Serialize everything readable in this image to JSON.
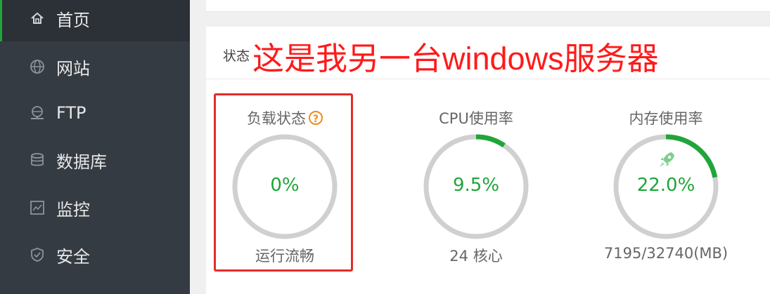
{
  "sidebar": {
    "items": [
      {
        "label": "首页",
        "icon": "home-icon",
        "active": true
      },
      {
        "label": "网站",
        "icon": "globe-icon",
        "active": false
      },
      {
        "label": "FTP",
        "icon": "ftp-icon",
        "active": false
      },
      {
        "label": "数据库",
        "icon": "database-icon",
        "active": false
      },
      {
        "label": "监控",
        "icon": "monitor-icon",
        "active": false
      },
      {
        "label": "安全",
        "icon": "shield-icon",
        "active": false
      }
    ]
  },
  "status": {
    "title": "状态",
    "note": "这是我另一台windows服务器",
    "help_icon": "?",
    "gauges": [
      {
        "title": "负载状态",
        "value": "0%",
        "fraction": 0.0,
        "sub": "运行流畅",
        "has_help": true
      },
      {
        "title": "CPU使用率",
        "value": "9.5%",
        "fraction": 0.095,
        "sub": "24 核心",
        "has_help": false
      },
      {
        "title": "内存使用率",
        "value": "22.0%",
        "fraction": 0.22,
        "sub": "7195/32740(MB)",
        "has_help": false,
        "icon": "rocket-icon"
      }
    ]
  },
  "colors": {
    "accent": "#20a53a",
    "sidebar_bg": "#353b42",
    "track": "#d0d0d0",
    "highlight": "#e32b2b",
    "note": "#ff1a1a",
    "help": "#f08c1a"
  }
}
